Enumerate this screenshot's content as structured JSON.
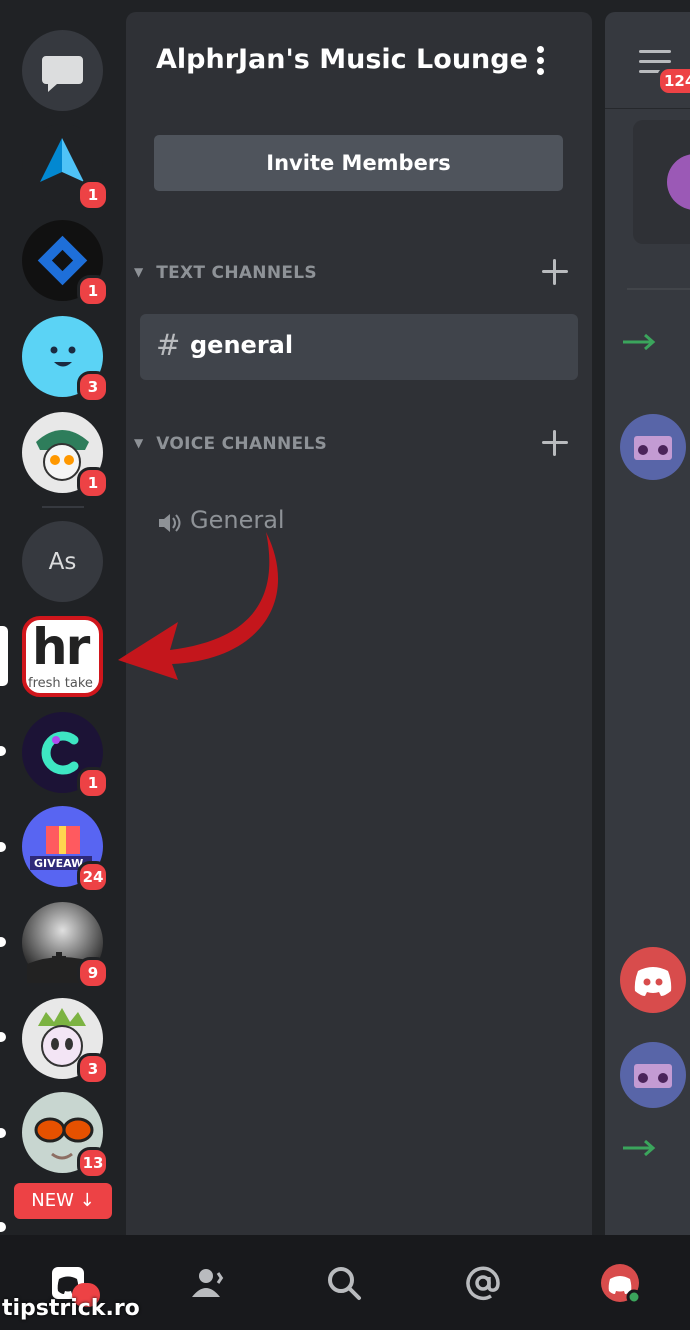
{
  "server": {
    "title": "AlphrJan's Music Lounge",
    "invite_label": "Invite Members"
  },
  "categories": {
    "text": "TEXT CHANNELS",
    "voice": "VOICE CHANNELS"
  },
  "channels": {
    "text": [
      {
        "name": "general",
        "prefix": "#"
      }
    ],
    "voice": [
      {
        "name": "General"
      }
    ]
  },
  "rail": {
    "servers": [
      {
        "icon": "direct-messages-icon",
        "badge": ""
      },
      {
        "icon": "arrow-logo-server",
        "badge": "1"
      },
      {
        "icon": "blue-diamond-server",
        "badge": "1"
      },
      {
        "icon": "smiley-face-server",
        "badge": "3"
      },
      {
        "icon": "cartoon-avatar-server",
        "badge": "1"
      },
      {
        "icon": "initials-server",
        "label": "As",
        "badge": ""
      },
      {
        "icon": "alphr-server",
        "label": "hr",
        "sublabel": "fresh take",
        "badge": "",
        "selected": true
      },
      {
        "icon": "c-logo-server",
        "badge": "1"
      },
      {
        "icon": "giveaway-server",
        "label": "GIVEAW",
        "badge": "24"
      },
      {
        "icon": "graveyard-server",
        "badge": "9"
      },
      {
        "icon": "crowned-avatar-server",
        "badge": "3"
      },
      {
        "icon": "sunglasses-avatar-server",
        "badge": "13"
      }
    ],
    "new_label": "NEW"
  },
  "chat": {
    "menu_badge": "124"
  },
  "watermark": "tipstrick.ro",
  "colors": {
    "background": "#202225",
    "panel": "#2f3136",
    "badge": "#ed4245",
    "selected_channel": "#40444b",
    "arrow_annotation": "#c4161c"
  }
}
